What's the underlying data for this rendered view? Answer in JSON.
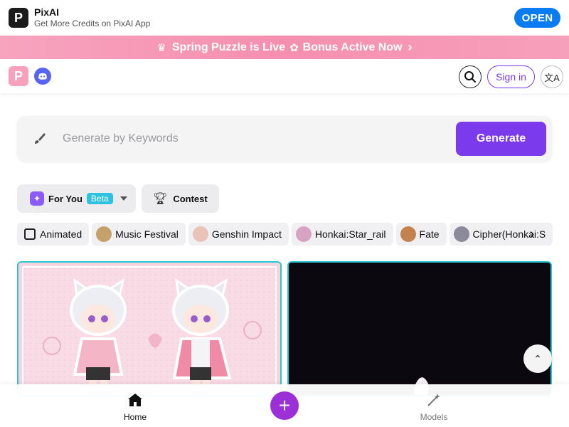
{
  "app_banner": {
    "name": "PixAI",
    "subtitle": "Get More Credits on PixAI App",
    "open_label": "OPEN",
    "logo_letter": "P"
  },
  "promo": {
    "text_1": "Spring Puzzle is Live",
    "text_2": "Bonus Active Now",
    "icons": [
      "crown-icon",
      "flower-icon",
      "chevron-right-icon"
    ]
  },
  "nav": {
    "logo_letter": "P",
    "signin_label": "Sign in",
    "lang_glyph": "文A"
  },
  "generate": {
    "placeholder": "Generate by Keywords",
    "value": "",
    "button_label": "Generate"
  },
  "tabs": {
    "for_you": {
      "label": "For You",
      "badge": "Beta"
    },
    "contest": {
      "label": "Contest"
    }
  },
  "chips": [
    {
      "label": "Animated",
      "thumb_color": ""
    },
    {
      "label": "Music Festival",
      "thumb_color": "#c4a06a"
    },
    {
      "label": "Genshin Impact",
      "thumb_color": "#e9c2b8"
    },
    {
      "label": "Honkai:Star_rail",
      "thumb_color": "#d8a3c3"
    },
    {
      "label": "Fate",
      "thumb_color": "#c4824e"
    },
    {
      "label": "Cipher(Honkai:S",
      "thumb_color": "#8a8a9a"
    }
  ],
  "bottom_nav": {
    "home_label": "Home",
    "models_label": "Models"
  },
  "colors": {
    "accent": "#7c3aed",
    "promo_bg": "#f58fb0",
    "open_blue": "#0a7cf2",
    "card_border": "#2cc5d6"
  }
}
